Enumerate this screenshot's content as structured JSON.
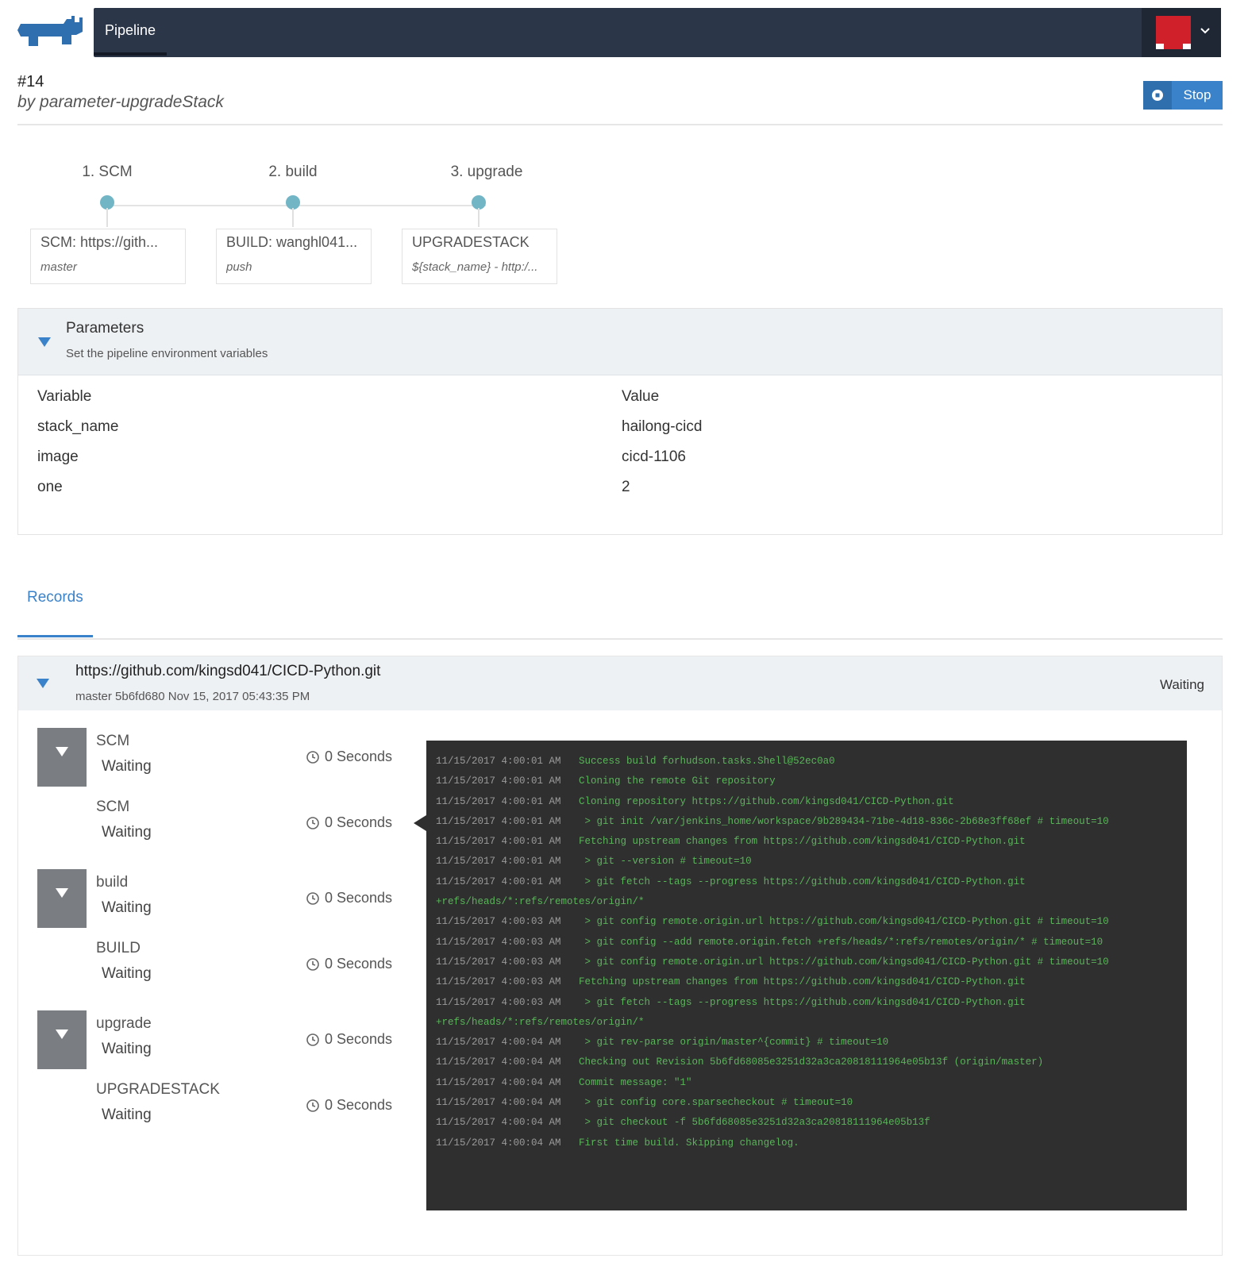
{
  "nav": {
    "active_tab": "Pipeline"
  },
  "run": {
    "number": "#14",
    "by": "by parameter-upgradeStack",
    "stop_label": "Stop"
  },
  "stages": [
    {
      "title": "1. SCM",
      "card_main": "SCM: https://gith...",
      "card_sub": "master"
    },
    {
      "title": "2. build",
      "card_main": "BUILD: wanghl041...",
      "card_sub": "push"
    },
    {
      "title": "3. upgrade",
      "card_main": "UPGRADESTACK",
      "card_sub": "${stack_name} - http:/..."
    }
  ],
  "parameters": {
    "title": "Parameters",
    "subtitle": "Set the pipeline environment variables",
    "col_variable": "Variable",
    "col_value": "Value",
    "rows": [
      {
        "variable": "stack_name",
        "value": "hailong-cicd"
      },
      {
        "variable": "image",
        "value": "cicd-1106"
      },
      {
        "variable": "one",
        "value": "2"
      }
    ]
  },
  "tabs": {
    "records": "Records"
  },
  "record": {
    "repo": "https://github.com/kingsd041/CICD-Python.git",
    "commit": "master 5b6fd680 Nov 15, 2017 05:43:35 PM",
    "status": "Waiting",
    "steps": [
      {
        "name": "SCM",
        "status": "Waiting",
        "time": "0 Seconds"
      },
      {
        "name": "SCM",
        "status": "Waiting",
        "time": "0 Seconds"
      },
      {
        "name": "build",
        "status": "Waiting",
        "time": "0 Seconds"
      },
      {
        "name": "BUILD",
        "status": "Waiting",
        "time": "0 Seconds"
      },
      {
        "name": "upgrade",
        "status": "Waiting",
        "time": "0 Seconds"
      },
      {
        "name": "UPGRADESTACK",
        "status": "Waiting",
        "time": "0 Seconds"
      }
    ]
  },
  "console_lines": [
    {
      "ts": "11/15/2017 4:00:01 AM",
      "msg": "Success build forhudson.tasks.Shell@52ec0a0"
    },
    {
      "ts": "11/15/2017 4:00:01 AM",
      "msg": "Cloning the remote Git repository"
    },
    {
      "ts": "11/15/2017 4:00:01 AM",
      "msg": "Cloning repository https://github.com/kingsd041/CICD-Python.git"
    },
    {
      "ts": "11/15/2017 4:00:01 AM",
      "msg": " > git init /var/jenkins_home/workspace/9b289434-71be-4d18-836c-2b68e3ff68ef # timeout=10"
    },
    {
      "ts": "11/15/2017 4:00:01 AM",
      "msg": "Fetching upstream changes from https://github.com/kingsd041/CICD-Python.git"
    },
    {
      "ts": "11/15/2017 4:00:01 AM",
      "msg": " > git --version # timeout=10"
    },
    {
      "ts": "11/15/2017 4:00:01 AM",
      "msg": " > git fetch --tags --progress https://github.com/kingsd041/CICD-Python.git"
    },
    {
      "ts": "",
      "msg": "+refs/heads/*:refs/remotes/origin/*"
    },
    {
      "ts": "11/15/2017 4:00:03 AM",
      "msg": " > git config remote.origin.url https://github.com/kingsd041/CICD-Python.git # timeout=10"
    },
    {
      "ts": "11/15/2017 4:00:03 AM",
      "msg": " > git config --add remote.origin.fetch +refs/heads/*:refs/remotes/origin/* # timeout=10"
    },
    {
      "ts": "11/15/2017 4:00:03 AM",
      "msg": " > git config remote.origin.url https://github.com/kingsd041/CICD-Python.git # timeout=10"
    },
    {
      "ts": "11/15/2017 4:00:03 AM",
      "msg": "Fetching upstream changes from https://github.com/kingsd041/CICD-Python.git"
    },
    {
      "ts": "11/15/2017 4:00:03 AM",
      "msg": " > git fetch --tags --progress https://github.com/kingsd041/CICD-Python.git"
    },
    {
      "ts": "",
      "msg": "+refs/heads/*:refs/remotes/origin/*"
    },
    {
      "ts": "11/15/2017 4:00:04 AM",
      "msg": " > git rev-parse origin/master^{commit} # timeout=10"
    },
    {
      "ts": "11/15/2017 4:00:04 AM",
      "msg": "Checking out Revision 5b6fd68085e3251d32a3ca20818111964e05b13f (origin/master)"
    },
    {
      "ts": "11/15/2017 4:00:04 AM",
      "msg": "Commit message: \"1\""
    },
    {
      "ts": "11/15/2017 4:00:04 AM",
      "msg": " > git config core.sparsecheckout # timeout=10"
    },
    {
      "ts": "11/15/2017 4:00:04 AM",
      "msg": " > git checkout -f 5b6fd68085e3251d32a3ca20818111964e05b13f"
    },
    {
      "ts": "11/15/2017 4:00:04 AM",
      "msg": "First time build. Skipping changelog."
    }
  ]
}
